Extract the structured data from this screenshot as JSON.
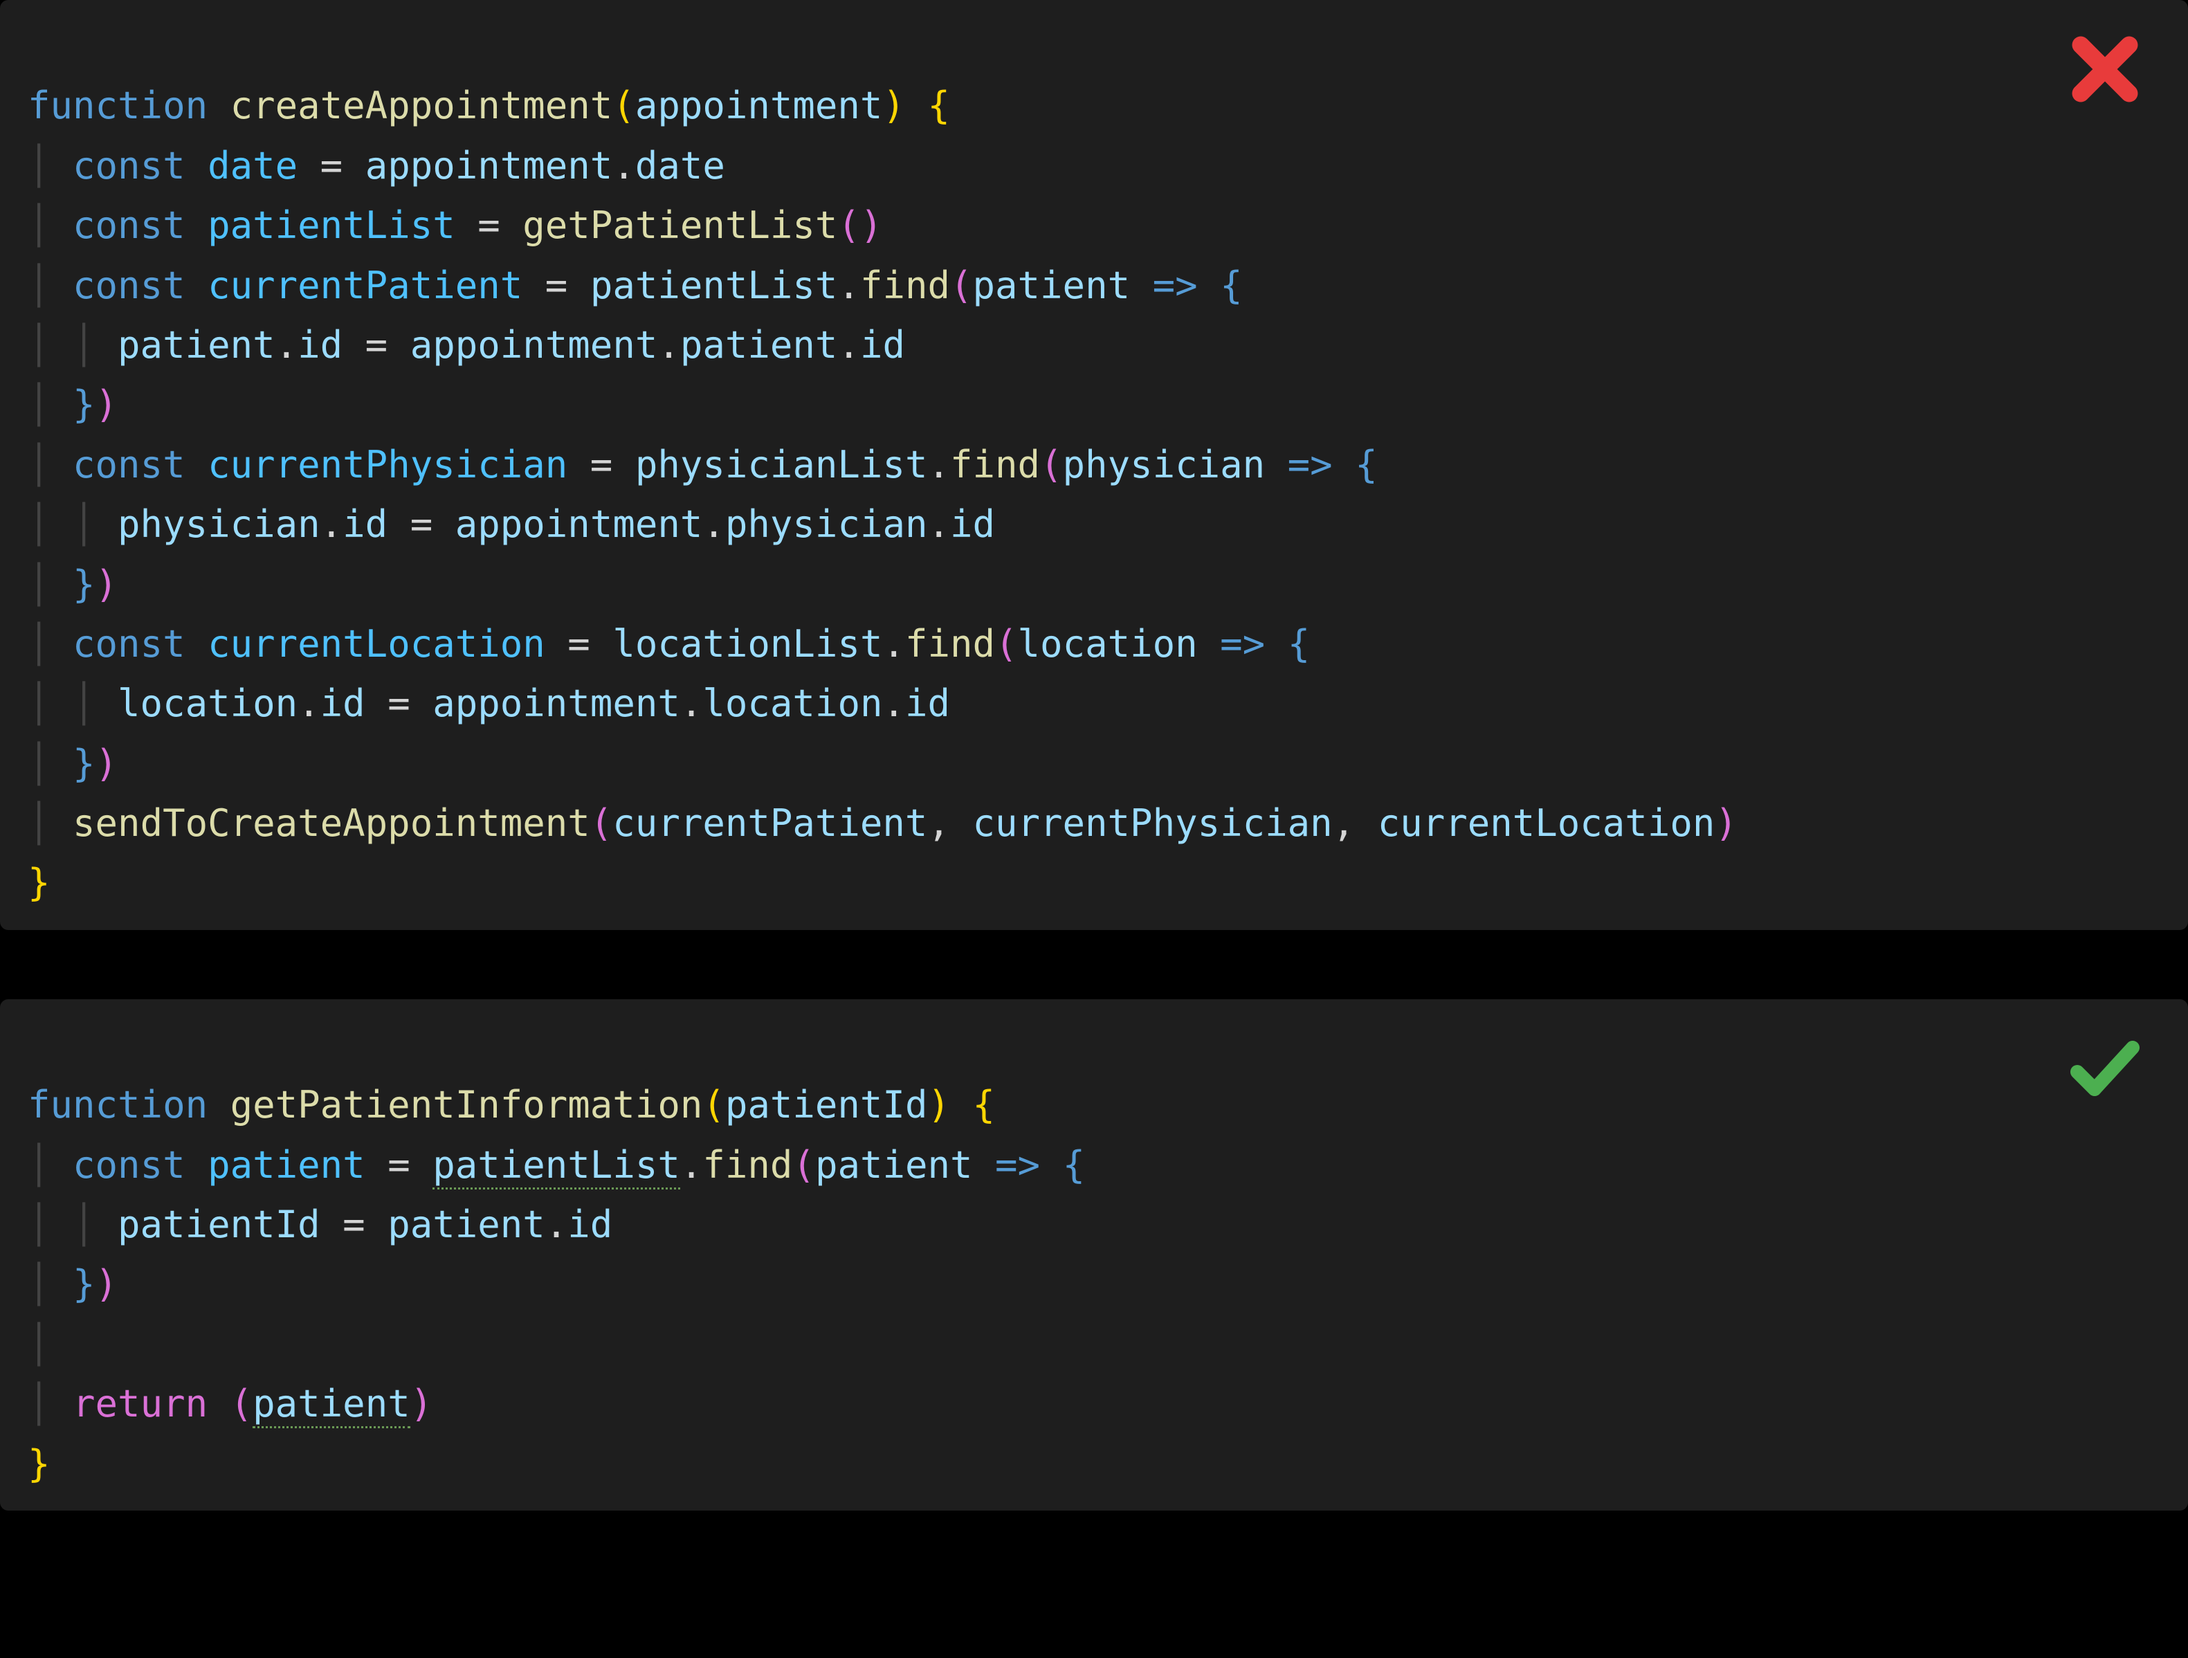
{
  "top": {
    "status": "bad",
    "lines": {
      "l1_kw": "function",
      "l1_fn": "createAppointment",
      "l1_op": "(",
      "l1_arg": "appointment",
      "l1_cp": ")",
      "l1_ob": " {",
      "l2_kw": "const",
      "l2_name": "date",
      "l2_eq": " = ",
      "l2_rhs1": "appointment",
      "l2_dot1": ".",
      "l2_rhs2": "date",
      "l3_kw": "const",
      "l3_name": "patientList",
      "l3_eq": " = ",
      "l3_fn": "getPatientList",
      "l3_pp": "()",
      "l4_kw": "const",
      "l4_name": "currentPatient",
      "l4_eq": " = ",
      "l4_obj": "patientList",
      "l4_dot": ".",
      "l4_find": "find",
      "l4_op": "(",
      "l4_param": "patient",
      "l4_arrow": " => ",
      "l4_ob": "{",
      "l5_a": "patient",
      "l5_dot1": ".",
      "l5_b": "id",
      "l5_eq": " = ",
      "l5_c": "appointment",
      "l5_dot2": ".",
      "l5_d": "patient",
      "l5_dot3": ".",
      "l5_e": "id",
      "l6_cb": "}",
      "l6_cp": ")",
      "l7_kw": "const",
      "l7_name": "currentPhysician",
      "l7_eq": " = ",
      "l7_obj": "physicianList",
      "l7_dot": ".",
      "l7_find": "find",
      "l7_op": "(",
      "l7_param": "physician",
      "l7_arrow": " => ",
      "l7_ob": "{",
      "l8_a": "physician",
      "l8_dot1": ".",
      "l8_b": "id",
      "l8_eq": " = ",
      "l8_c": "appointment",
      "l8_dot2": ".",
      "l8_d": "physician",
      "l8_dot3": ".",
      "l8_e": "id",
      "l9_cb": "}",
      "l9_cp": ")",
      "l10_kw": "const",
      "l10_name": "currentLocation",
      "l10_eq": " = ",
      "l10_obj": "locationList",
      "l10_dot": ".",
      "l10_find": "find",
      "l10_op": "(",
      "l10_param": "location",
      "l10_arrow": " => ",
      "l10_ob": "{",
      "l11_a": "location",
      "l11_dot1": ".",
      "l11_b": "id",
      "l11_eq": " = ",
      "l11_c": "appointment",
      "l11_dot2": ".",
      "l11_d": "location",
      "l11_dot3": ".",
      "l11_e": "id",
      "l12_cb": "}",
      "l12_cp": ")",
      "l13_fn": "sendToCreateAppointment",
      "l13_op": "(",
      "l13_a1": "currentPatient",
      "l13_c1": ", ",
      "l13_a2": "currentPhysician",
      "l13_c2": ", ",
      "l13_a3": "currentLocation",
      "l13_cp": ")",
      "l14_cb": "}"
    }
  },
  "bottom": {
    "status": "good",
    "lines": {
      "l1_kw": "function",
      "l1_fn": "getPatientInformation",
      "l1_op": "(",
      "l1_arg": "patientId",
      "l1_cp": ")",
      "l1_ob": " {",
      "l2_kw": "const",
      "l2_name": "patient",
      "l2_eq": " = ",
      "l2_obj": "patientList",
      "l2_dot": ".",
      "l2_find": "find",
      "l2_op": "(",
      "l2_param": "patient",
      "l2_arrow": " => ",
      "l2_ob": "{",
      "l3_a": "patientId",
      "l3_eq": " = ",
      "l3_b": "patient",
      "l3_dot": ".",
      "l3_c": "id",
      "l4_cb": "}",
      "l4_cp": ")",
      "l5_kw": "return",
      "l5_op": " (",
      "l5_v": "patient",
      "l5_cp": ")",
      "l6_cb": "}"
    }
  },
  "icons": {
    "bad": "cross-icon",
    "good": "check-icon"
  },
  "colors": {
    "bad": "#e83b3b",
    "good": "#4caf50",
    "background": "#1e1e1e"
  }
}
